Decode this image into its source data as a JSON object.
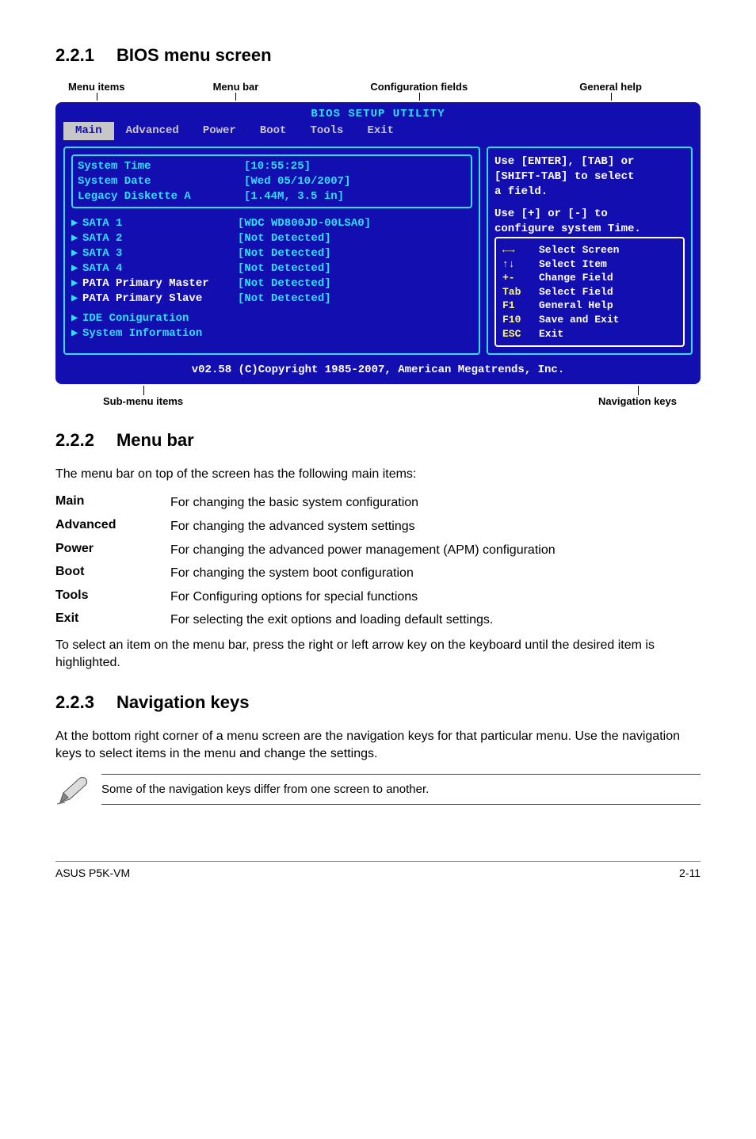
{
  "sections": {
    "s221": {
      "num": "2.2.1",
      "title": "BIOS menu screen"
    },
    "s222": {
      "num": "2.2.2",
      "title": "Menu bar"
    },
    "s223": {
      "num": "2.2.3",
      "title": "Navigation keys"
    }
  },
  "callouts_top": {
    "menu_items": "Menu items",
    "menu_bar": "Menu bar",
    "config_fields": "Configuration fields",
    "general_help": "General help"
  },
  "callouts_bottom": {
    "submenu": "Sub-menu items",
    "navkeys": "Navigation keys"
  },
  "bios": {
    "title": "BIOS SETUP UTILITY",
    "tabs": [
      "Main",
      "Advanced",
      "Power",
      "Boot",
      "Tools",
      "Exit"
    ],
    "rows": [
      {
        "label": "System Time",
        "value": "[10:55:25]",
        "white": false,
        "tri": false
      },
      {
        "label": "System Date",
        "value": "[Wed 05/10/2007]",
        "white": false,
        "tri": false
      },
      {
        "label": "Legacy Diskette A",
        "value": "[1.44M, 3.5 in]",
        "white": false,
        "tri": false
      }
    ],
    "sata": [
      {
        "label": "SATA 1",
        "value": "[WDC WD800JD-00LSA0]"
      },
      {
        "label": "SATA 2",
        "value": "[Not Detected]"
      },
      {
        "label": "SATA 3",
        "value": "[Not Detected]"
      },
      {
        "label": "SATA 4",
        "value": "[Not Detected]"
      },
      {
        "label": "PATA Primary Master",
        "value": "[Not Detected]"
      },
      {
        "label": "PATA Primary Slave",
        "value": "[Not Detected]"
      }
    ],
    "bottom_group": [
      "IDE Coniguration",
      "System Information"
    ],
    "help_lines": [
      "Use [ENTER], [TAB] or",
      "[SHIFT-TAB] to select",
      "a field.",
      "",
      "Use [+] or [-] to",
      "configure system Time."
    ],
    "nav": [
      {
        "key": "←→",
        "desc": "Select Screen"
      },
      {
        "key": "↑↓",
        "desc": "Select Item"
      },
      {
        "key": "+-",
        "desc": "Change Field"
      },
      {
        "key": "Tab",
        "desc": "Select Field"
      },
      {
        "key": "F1",
        "desc": "General Help"
      },
      {
        "key": "F10",
        "desc": "Save and Exit"
      },
      {
        "key": "ESC",
        "desc": "Exit"
      }
    ],
    "footer": "v02.58 (C)Copyright 1985-2007, American Megatrends, Inc."
  },
  "text": {
    "menu_bar_intro": "The menu bar on top of the screen has the following main items:",
    "select_hint": "To select an item on the menu bar, press the right or left arrow key on the keyboard until the desired item is highlighted.",
    "nav_intro": "At the bottom right corner of a menu screen are the navigation keys for that particular menu. Use the navigation keys to select items in the menu and change the settings.",
    "note": "Some of the navigation keys differ from one screen to another."
  },
  "desc": {
    "main": {
      "term": "Main",
      "def": "For changing the basic system configuration"
    },
    "advanced": {
      "term": "Advanced",
      "def": "For changing the advanced system settings"
    },
    "power": {
      "term": "Power",
      "def": "For changing the advanced power management (APM) configuration"
    },
    "boot": {
      "term": "Boot",
      "def": "For changing the system boot configuration"
    },
    "tools": {
      "term": "Tools",
      "def": "For Configuring options for special functions"
    },
    "exit": {
      "term": "Exit",
      "def": "For selecting the exit options and loading default settings."
    }
  },
  "footer": {
    "left": "ASUS P5K-VM",
    "right": "2-11"
  }
}
